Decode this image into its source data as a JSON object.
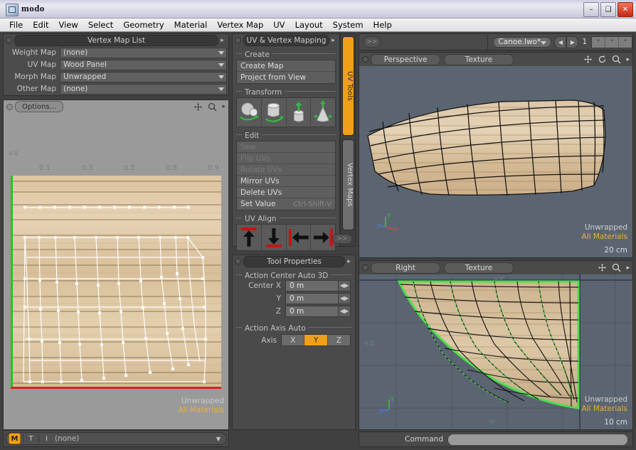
{
  "window": {
    "title": "modo",
    "icon": "app-icon",
    "controls": {
      "minimize": "–",
      "maximize": "❑",
      "close": "✕"
    }
  },
  "menu": {
    "items": [
      "File",
      "Edit",
      "View",
      "Select",
      "Geometry",
      "Material",
      "Vertex Map",
      "UV",
      "Layout",
      "System",
      "Help"
    ]
  },
  "vertex_map_list": {
    "title": "Vertex Map List",
    "rows": [
      {
        "label": "Weight Map",
        "value": "(none)"
      },
      {
        "label": "UV Map",
        "value": "Wood Panel"
      },
      {
        "label": "Morph Map",
        "value": "Unwrapped"
      },
      {
        "label": "Other Map",
        "value": "(none)"
      }
    ]
  },
  "uv_editor": {
    "options_label": "Options...",
    "v_axis_label": "+V",
    "ruler_ticks": [
      "0.1",
      "0.3",
      "0.5",
      "0.8",
      "0.9"
    ],
    "overlay_mesh": "Unwrapped",
    "overlay_material": "All Materials",
    "icons": [
      "move-icon",
      "zoom-icon",
      "chevron-right-icon"
    ]
  },
  "status_strip": {
    "mode_buttons": [
      {
        "label": "M",
        "active": true
      },
      {
        "label": "T",
        "active": false
      },
      {
        "label": "I",
        "active": false
      }
    ],
    "value": "(none)"
  },
  "uv_mapping_panel": {
    "title": "UV & Vertex Mapping",
    "sections": [
      {
        "name": "Create",
        "items": [
          {
            "label": "Create Map",
            "disabled": false
          },
          {
            "label": "Project from View",
            "disabled": false
          }
        ]
      },
      {
        "name": "Transform",
        "items": []
      },
      {
        "name": "Edit",
        "items": [
          {
            "label": "Sew",
            "disabled": true,
            "shortcut": ""
          },
          {
            "label": "Flip UVs",
            "disabled": true,
            "shortcut": ""
          },
          {
            "label": "Rotate UVs",
            "disabled": true,
            "shortcut": ""
          },
          {
            "label": "Mirror UVs",
            "disabled": false,
            "shortcut": ""
          },
          {
            "label": "Delete UVs",
            "disabled": false,
            "shortcut": ""
          },
          {
            "label": "Set Value",
            "disabled": false,
            "shortcut": "Ctrl-Shift-V"
          }
        ]
      },
      {
        "name": "UV Align",
        "items": []
      }
    ],
    "transform_icons": [
      "rotate-sphere-icon",
      "bend-cylinder-icon",
      "extrude-cylinder-icon",
      "taper-cone-icon"
    ],
    "align_icons": [
      "align-up-icon",
      "align-down-icon",
      "align-left-icon",
      "align-right-icon"
    ],
    "expand_label": ">>"
  },
  "side_tabs": [
    {
      "label": "UV Tools",
      "active": true
    },
    {
      "label": "Vertex Maps",
      "active": false
    }
  ],
  "tool_properties": {
    "title": "Tool Properties",
    "sections": [
      {
        "name": "Action Center Auto 3D",
        "fields": [
          {
            "label": "Center X",
            "value": "0 m"
          },
          {
            "label": "Y",
            "value": "0 m"
          },
          {
            "label": "Z",
            "value": "0 m"
          }
        ]
      },
      {
        "name": "Action Axis Auto",
        "axis_label": "Axis",
        "axis_options": [
          {
            "label": "X",
            "active": false
          },
          {
            "label": "Y",
            "active": true
          },
          {
            "label": "Z",
            "active": false
          }
        ]
      }
    ]
  },
  "scene_toolbar": {
    "expand_label": ">>",
    "file_name": "Canoe.lwo*",
    "prev_label": "◀",
    "next_label": "▶",
    "layer_number": "1"
  },
  "viewports": [
    {
      "view_label": "Perspective",
      "shading_label": "Texture",
      "mesh_name": "Unwrapped",
      "material_name": "All Materials",
      "scale": "20 cm",
      "axis_labels": [],
      "icons": [
        "move-icon",
        "rotate-icon",
        "zoom-icon",
        "chevron-right-icon"
      ]
    },
    {
      "view_label": "Right",
      "shading_label": "Texture",
      "mesh_name": "Unwrapped",
      "material_name": "All Materials",
      "scale": "10 cm",
      "axis_labels": [
        "+Y",
        "+Z",
        "-Y"
      ],
      "icons": [
        "move-icon",
        "zoom-icon",
        "chevron-right-icon"
      ]
    }
  ],
  "command_bar": {
    "label": "Command",
    "value": ""
  },
  "colors": {
    "accent": "#f0a018",
    "panel": "#4a4a4a",
    "viewport_bg": "#5b6572",
    "uv_bg": "#9a9a9a",
    "u_axis": "#e02020",
    "v_axis": "#22c422"
  }
}
